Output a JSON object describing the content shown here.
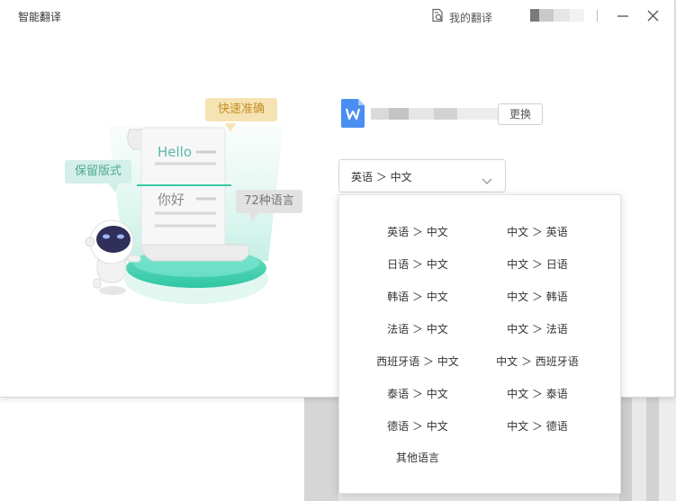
{
  "window": {
    "title": "智能翻译",
    "my_translations_label": "我的翻译"
  },
  "illustration": {
    "bubble_quick": "快速准确",
    "bubble_format": "保留版式",
    "bubble_languages": "72种语言",
    "scroll_hello": "Hello",
    "scroll_nihao": "你好"
  },
  "file": {
    "replace_label": "更换"
  },
  "language_select": {
    "selected": "英语 ＞ 中文"
  },
  "dropdown": {
    "left": [
      "英语 ＞ 中文",
      "日语 ＞ 中文",
      "韩语 ＞ 中文",
      "法语 ＞ 中文",
      "西班牙语 ＞ 中文",
      "泰语 ＞ 中文",
      "德语 ＞ 中文",
      "其他语言"
    ],
    "right": [
      "中文 ＞ 英语",
      "中文 ＞ 日语",
      "中文 ＞ 韩语",
      "中文 ＞ 法语",
      "中文 ＞ 西班牙语",
      "中文 ＞ 泰语",
      "中文 ＞ 德语"
    ]
  },
  "colors": {
    "accent_teal": "#36c9a6",
    "word_blue": "#4a8ef2",
    "bubble_gold": "#c48f23"
  }
}
